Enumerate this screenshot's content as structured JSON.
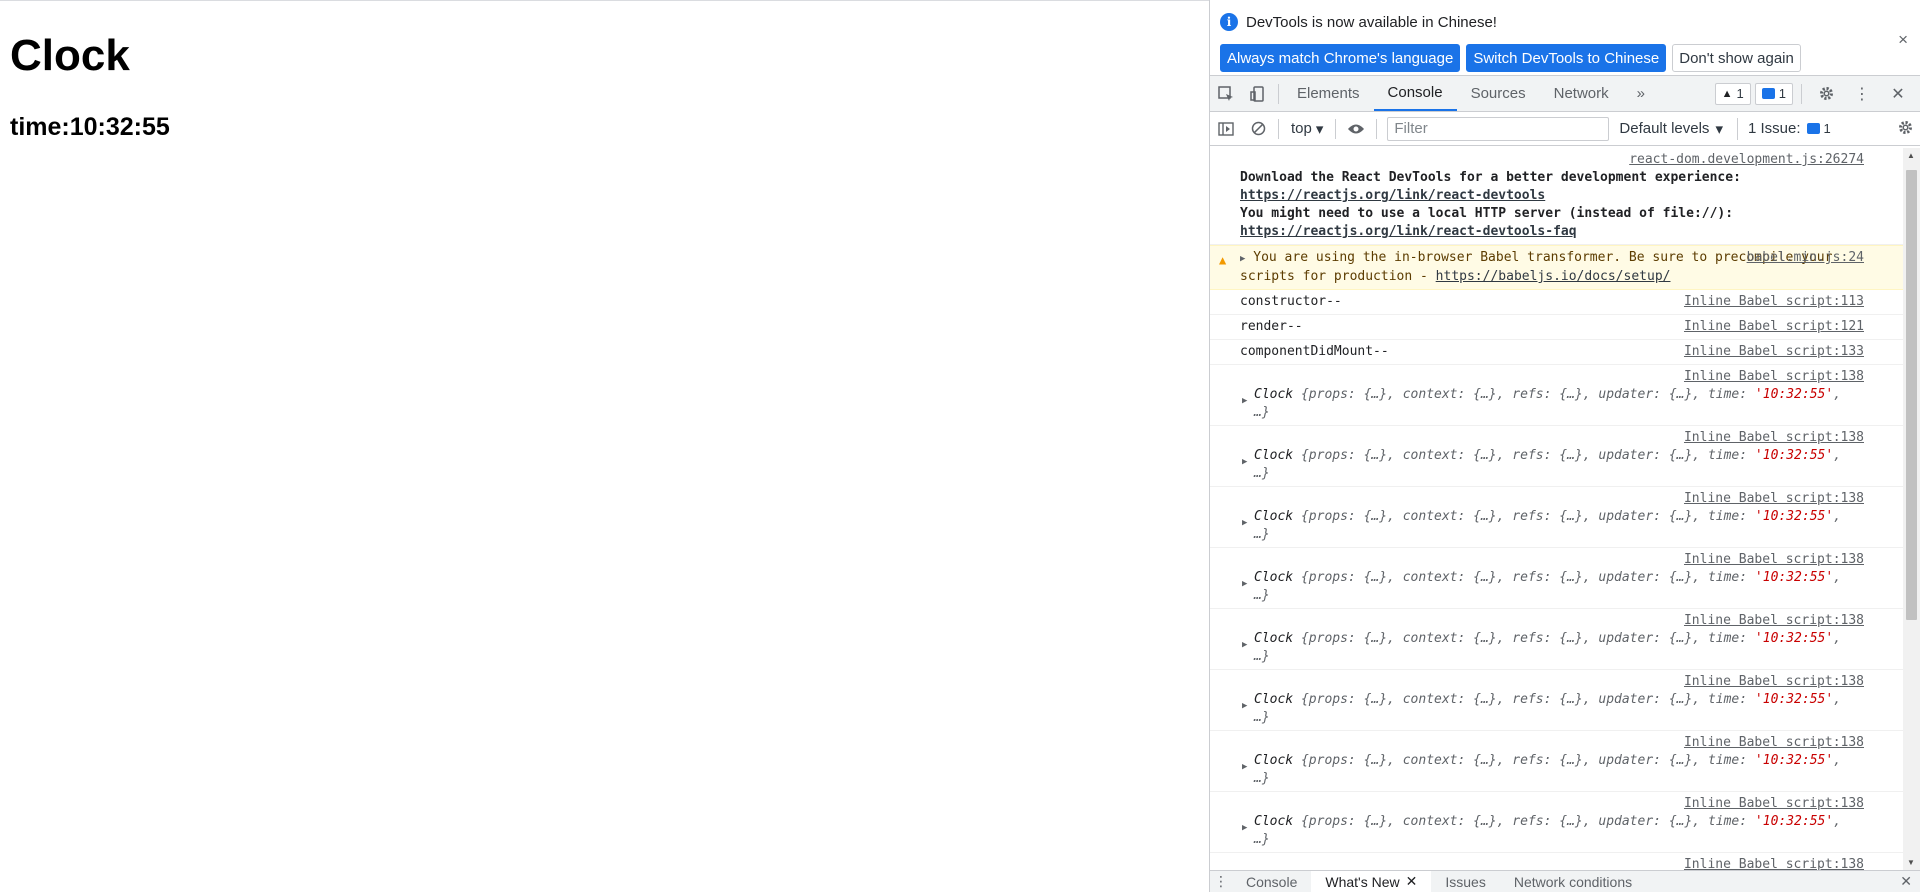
{
  "page": {
    "heading": "Clock",
    "time_line": "time:10:32:55"
  },
  "devtools": {
    "infobar": {
      "message": "DevTools is now available in Chinese!",
      "btn_match": "Always match Chrome's language",
      "btn_switch": "Switch DevTools to Chinese",
      "btn_dismiss": "Don't show again",
      "close": "×"
    },
    "tabs": [
      "Elements",
      "Console",
      "Sources",
      "Network"
    ],
    "more_tabs": "»",
    "warning_count": "1",
    "issue_count": "1",
    "toolbar": {
      "context": "top",
      "filter_placeholder": "Filter",
      "levels": "Default levels",
      "issues_label": "1 Issue:",
      "issues_count": "1"
    },
    "messages": {
      "react_src": "react-dom.development.js:26274",
      "react_line1": "Download the React DevTools for a better development experience: ",
      "react_link1": "https://reactjs.org/link/react-devtools",
      "react_line2": "You might need to use a local HTTP server (instead of file://): ",
      "react_link2": "https://reactjs.org/link/react-devtools-faq",
      "babel_src": "babel.min.js:24",
      "babel_text": "You are using the in-browser Babel transformer. Be sure to precompile your scripts for production - ",
      "babel_link": "https://babeljs.io/docs/setup/",
      "constructor_text": "constructor--",
      "constructor_src": "Inline Babel script:113",
      "render_text": "render--",
      "render_src": "Inline Babel script:121",
      "didmount_text": "componentDidMount--",
      "didmount_src": "Inline Babel script:133",
      "clock_src": "Inline Babel script:138",
      "clock_name": "Clock",
      "clock_body": " {props: {…}, context: {…}, refs: {…}, updater: {…}, time: ",
      "clock_time": "'10:32:55'",
      "clock_tail": ", …}"
    },
    "drawer_tabs": [
      "Console",
      "What's New",
      "Issues",
      "Network conditions"
    ]
  },
  "colors": {
    "accent": "#1a73e8",
    "warn_bg": "#fffbe5",
    "string_red": "#c80000"
  }
}
